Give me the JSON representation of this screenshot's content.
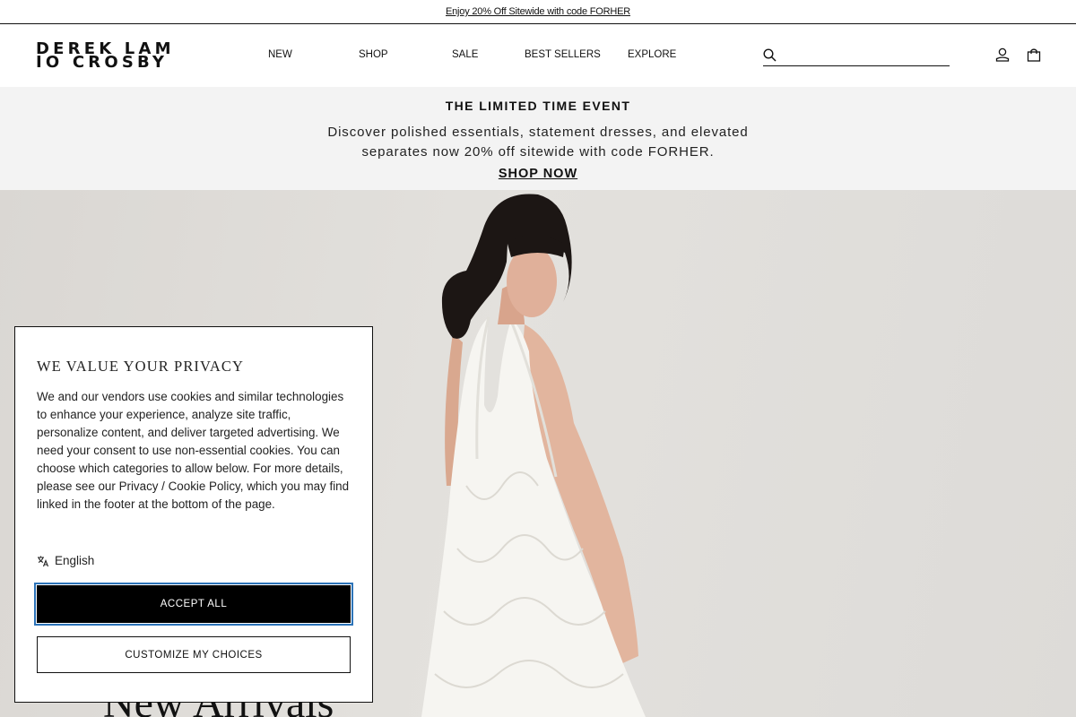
{
  "announcement": {
    "text": "Enjoy 20% Off Sitewide with code FORHER"
  },
  "brand": {
    "logo_line1": "DEREK LAM",
    "logo_line2": "IO CROSBY"
  },
  "nav": {
    "items": [
      "NEW",
      "SHOP",
      "SALE",
      "BEST SELLERS",
      "EXPLORE"
    ]
  },
  "search": {
    "value": "",
    "placeholder": ""
  },
  "header_icons": [
    "search-icon",
    "account-icon",
    "shopping-bag-icon"
  ],
  "event": {
    "title": "THE LIMITED TIME EVENT",
    "description": "Discover polished essentials, statement dresses, and elevated separates now 20% off sitewide with code FORHER.",
    "cta": "SHOP NOW"
  },
  "hero": {
    "headline": "New Arrivals"
  },
  "cookie_banner": {
    "title": "WE VALUE YOUR PRIVACY",
    "body": "We and our vendors use cookies and similar technologies to enhance your experience, analyze site traffic, personalize content, and deliver targeted advertising. We need your consent to use non-essential cookies. You can choose which categories to allow below. For more details, please see our Privacy / Cookie Policy, which you may find linked in the footer at the bottom of the page.",
    "language": "English",
    "accept_label": "ACCEPT ALL",
    "customize_label": "CUSTOMIZE MY CHOICES"
  },
  "colors": {
    "text": "#111111",
    "event_bg": "#f3f3f3",
    "accept_bg": "#000000",
    "focus_ring": "#2c73b8"
  }
}
